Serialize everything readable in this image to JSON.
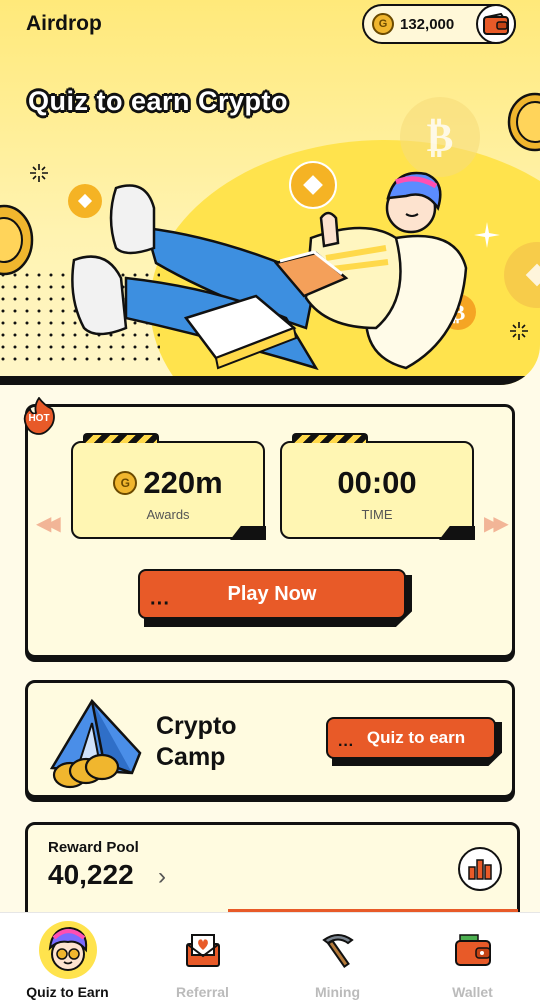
{
  "header": {
    "title": "Airdrop",
    "balance": "132,000",
    "coin_icon": "coin-icon",
    "wallet_icon": "wallet-icon"
  },
  "hero": {
    "headline": "Quiz to earn Crypto"
  },
  "quiz_card": {
    "badge": "HOT",
    "awards_value": "220m",
    "awards_label": "Awards",
    "time_value": "00:00",
    "time_label": "TIME",
    "play_label": "Play Now"
  },
  "camp_card": {
    "title": "Crypto Camp",
    "button_label": "Quiz to earn"
  },
  "pool_card": {
    "label": "Reward Pool",
    "value": "40,222"
  },
  "nav": {
    "items": [
      {
        "label": "Quiz to Earn",
        "icon": "avatar-icon",
        "active": true
      },
      {
        "label": "Referral",
        "icon": "envelope-heart-icon",
        "active": false
      },
      {
        "label": "Mining",
        "icon": "pickaxe-icon",
        "active": false
      },
      {
        "label": "Wallet",
        "icon": "wallet-icon",
        "active": false
      }
    ]
  },
  "colors": {
    "accent": "#e85a28",
    "yellow": "#ffe34d",
    "card_bg": "#fffbe0",
    "coin": "#f0b62e"
  }
}
